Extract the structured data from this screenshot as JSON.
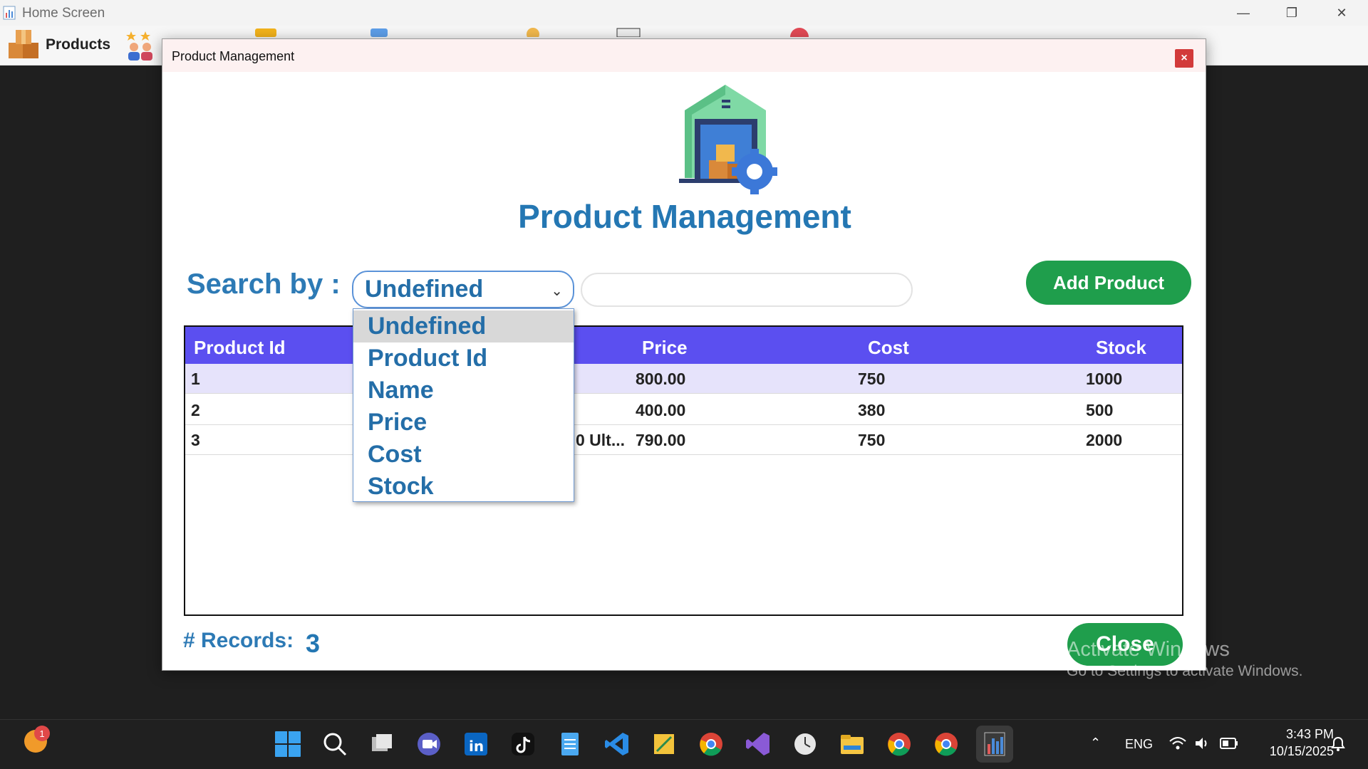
{
  "main_window": {
    "title": "Home Screen",
    "toolbar": {
      "products_label": "Products"
    },
    "controls": {
      "minimize": "—",
      "restore": "❐",
      "close": "✕"
    }
  },
  "dialog": {
    "title": "Product Management",
    "close_glyph": "×",
    "heading": "Product Management",
    "search": {
      "label": "Search by :",
      "selected": "Undefined",
      "input_value": "",
      "options": [
        "Undefined",
        "Product Id",
        "Name",
        "Price",
        "Cost",
        "Stock"
      ]
    },
    "add_button": "Add Product",
    "table": {
      "headers": [
        "Product Id",
        "Price",
        "Cost",
        "Stock"
      ],
      "rows": [
        {
          "id": "1",
          "name_tail": "",
          "price": "800.00",
          "cost": "750",
          "stock": "1000"
        },
        {
          "id": "2",
          "name_tail": "",
          "price": "400.00",
          "cost": "380",
          "stock": "500"
        },
        {
          "id": "3",
          "name_tail": "0 Ult...",
          "price": "790.00",
          "cost": "750",
          "stock": "2000"
        }
      ]
    },
    "records_label": "# Records:",
    "records_value": "3",
    "close_button": "Close"
  },
  "watermark": {
    "line1": "Activate Windows",
    "line2": "Go to Settings to activate Windows."
  },
  "taskbar": {
    "notification_count": "1",
    "language": "ENG",
    "time": "3:43 PM",
    "date": "10/15/2025"
  },
  "colors": {
    "accent_blue": "#2477b3",
    "table_header": "#5b4ff0",
    "green_button": "#1f9e4c"
  }
}
